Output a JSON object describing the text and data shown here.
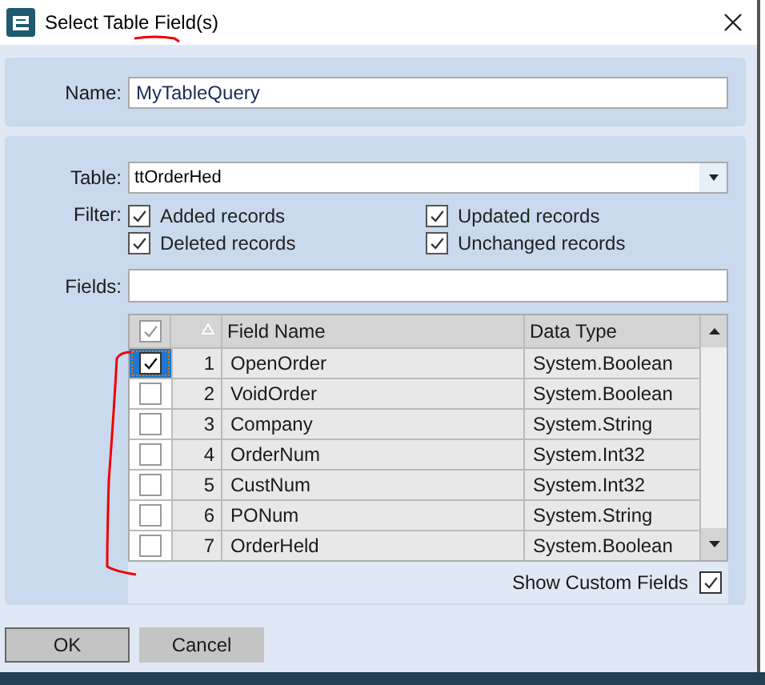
{
  "window": {
    "title": "Select Table Field(s)"
  },
  "name": {
    "label": "Name:",
    "value": "MyTableQuery"
  },
  "table": {
    "label": "Table:",
    "value": "ttOrderHed"
  },
  "filter": {
    "label": "Filter:",
    "options": [
      {
        "label": "Added records",
        "checked": true
      },
      {
        "label": "Updated records",
        "checked": true
      },
      {
        "label": "Deleted records",
        "checked": true
      },
      {
        "label": "Unchanged records",
        "checked": true
      }
    ]
  },
  "fields": {
    "label": "Fields:"
  },
  "grid": {
    "header_checked": true,
    "columns": [
      "Field Name",
      "Data Type"
    ],
    "rows": [
      {
        "number": "1",
        "field_name": "OpenOrder",
        "data_type": "System.Boolean",
        "checked": true,
        "selected": true
      },
      {
        "number": "2",
        "field_name": "VoidOrder",
        "data_type": "System.Boolean",
        "checked": false,
        "selected": false
      },
      {
        "number": "3",
        "field_name": "Company",
        "data_type": "System.String",
        "checked": false,
        "selected": false
      },
      {
        "number": "4",
        "field_name": "OrderNum",
        "data_type": "System.Int32",
        "checked": false,
        "selected": false
      },
      {
        "number": "5",
        "field_name": "CustNum",
        "data_type": "System.Int32",
        "checked": false,
        "selected": false
      },
      {
        "number": "6",
        "field_name": "PONum",
        "data_type": "System.String",
        "checked": false,
        "selected": false
      },
      {
        "number": "7",
        "field_name": "OrderHeld",
        "data_type": "System.Boolean",
        "checked": false,
        "selected": false
      }
    ]
  },
  "show_custom_fields": {
    "label": "Show Custom Fields",
    "checked": true
  },
  "buttons": [
    "OK",
    "Cancel"
  ]
}
